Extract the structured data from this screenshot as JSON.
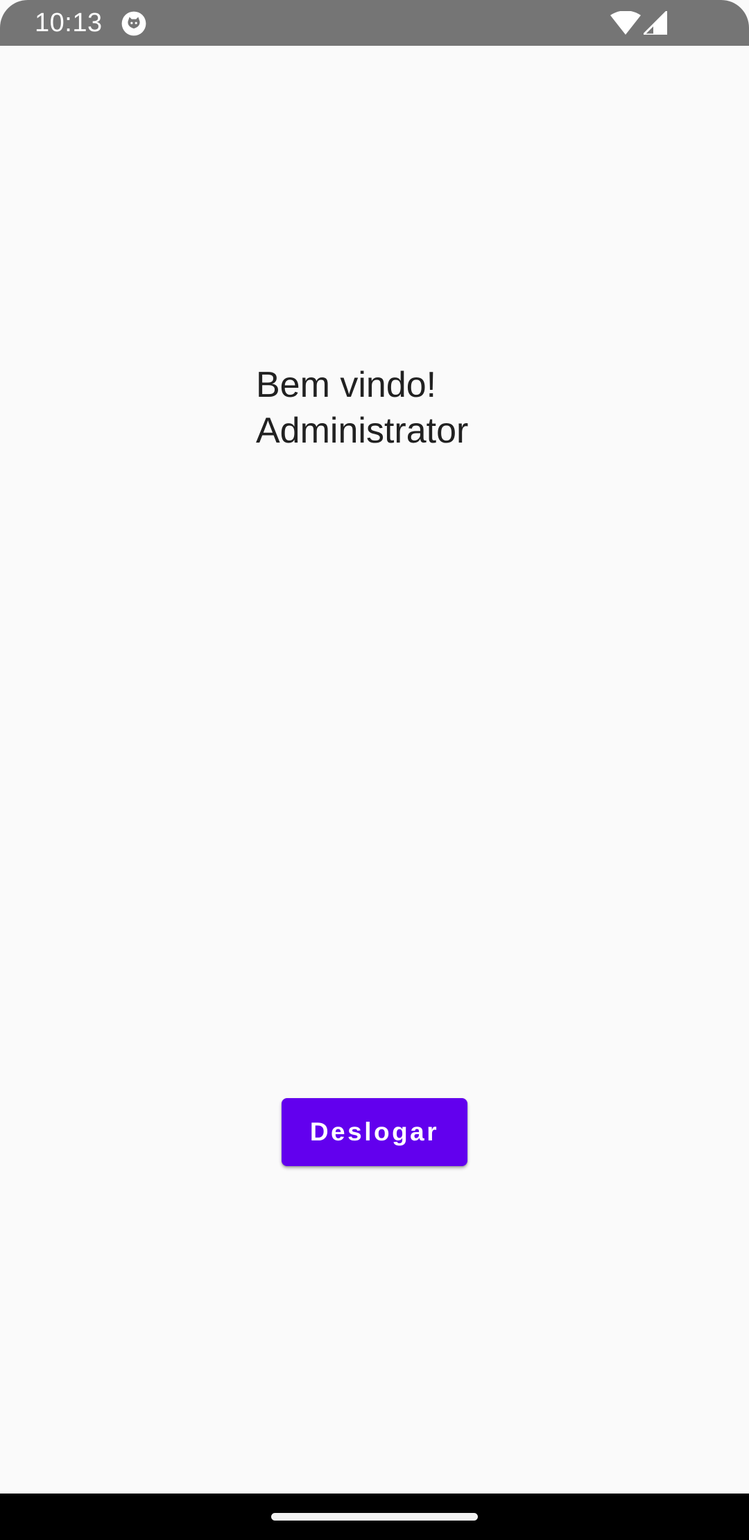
{
  "status_bar": {
    "time": "10:13",
    "icons": [
      "app-notification-icon",
      "wifi-icon",
      "cell-signal-icon"
    ],
    "background_color": "#757575"
  },
  "welcome": {
    "line1": "Bem vindo!",
    "line2": "Administrator"
  },
  "logout_button": {
    "label": "Deslogar",
    "color": "#6200ee"
  },
  "nav_bar": {
    "background_color": "#000000"
  }
}
